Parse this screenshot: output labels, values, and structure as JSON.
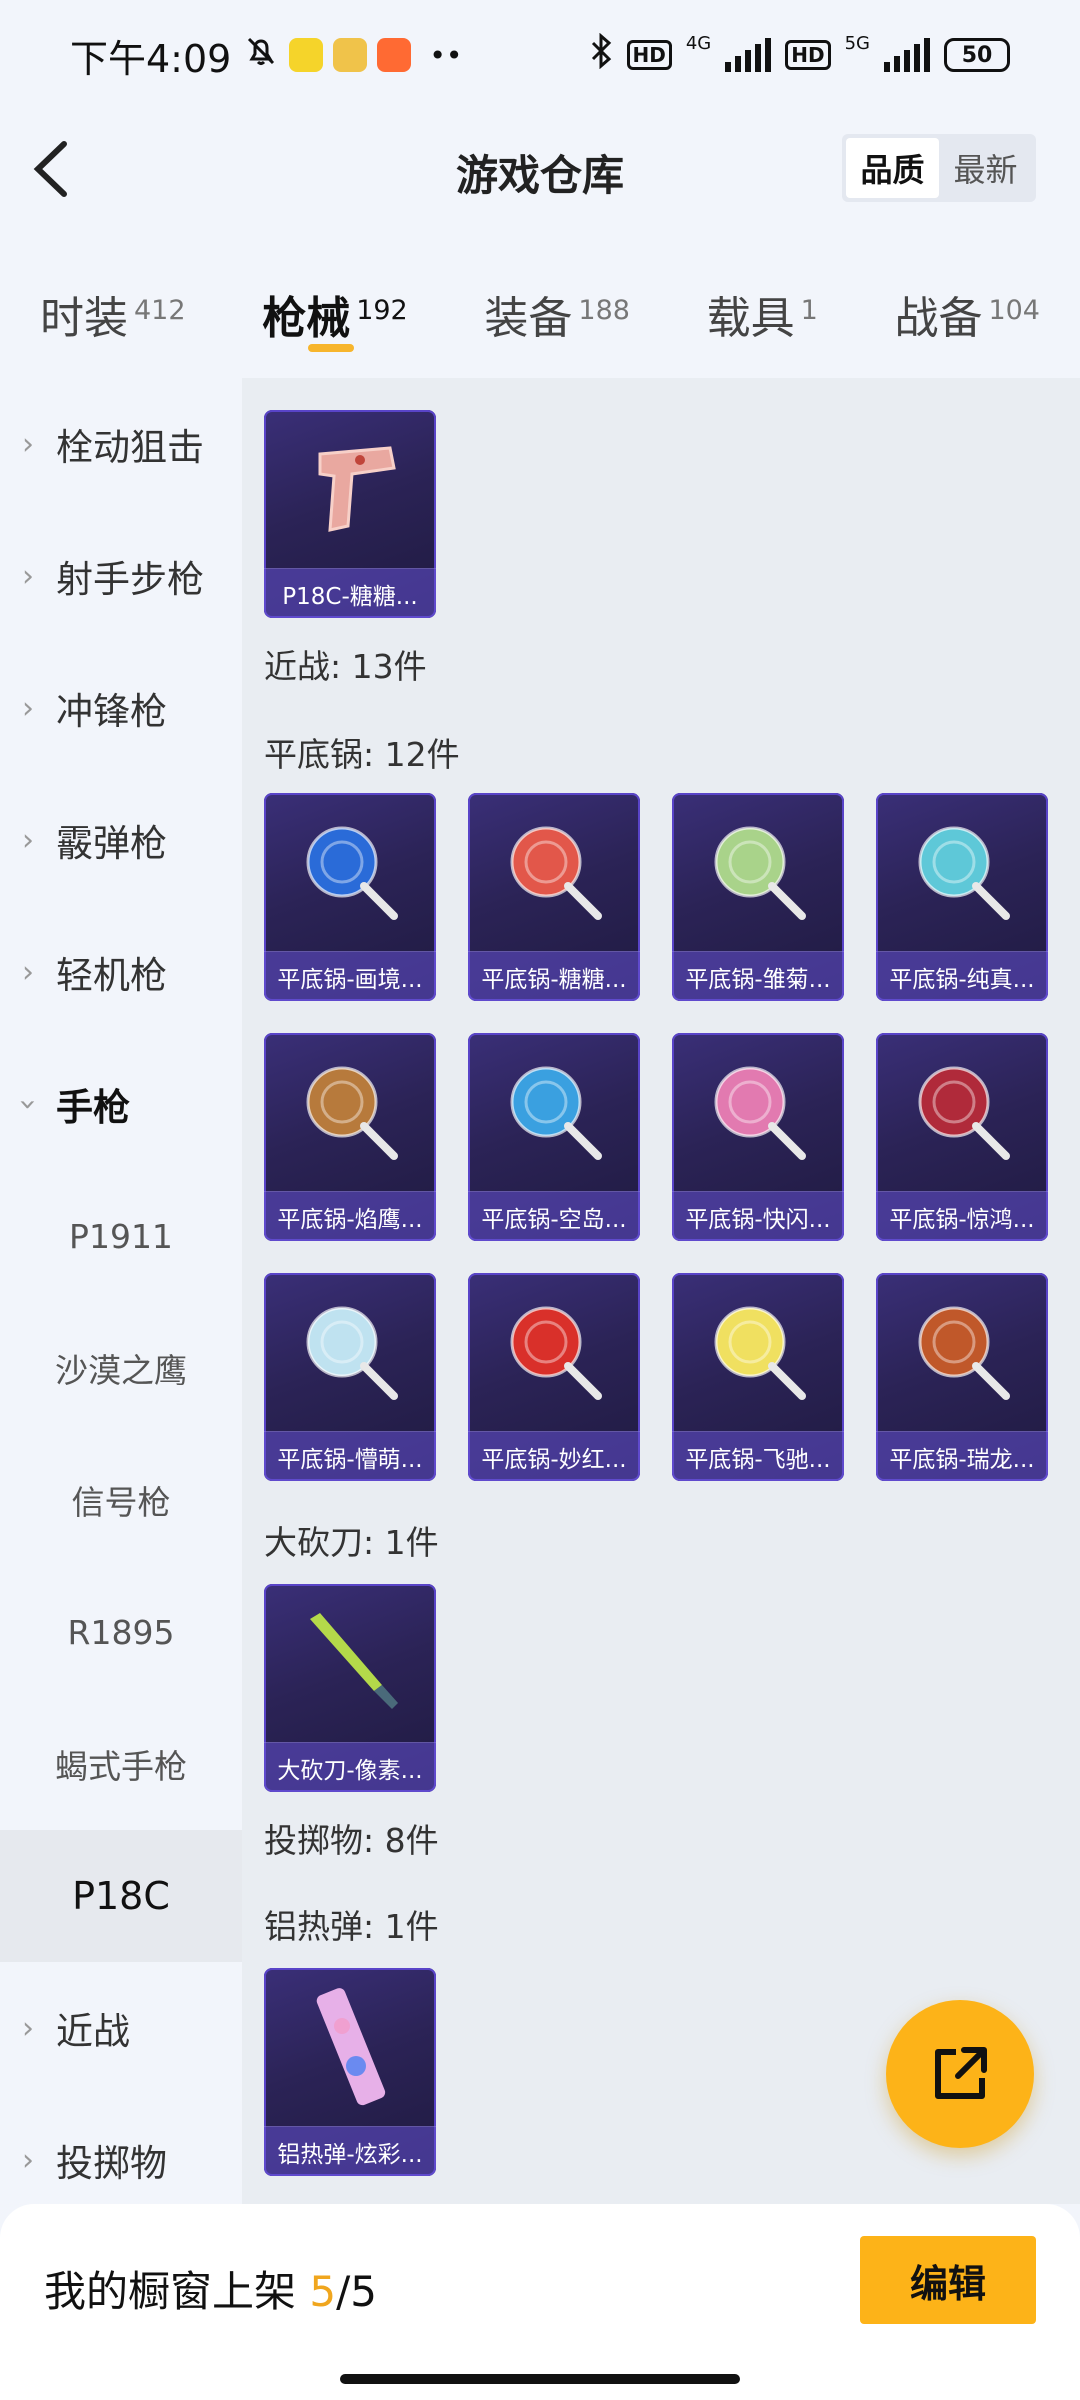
{
  "status_bar": {
    "time": "下午4:09",
    "battery": "50",
    "net1": "4G",
    "net2": "5G",
    "hd": "HD",
    "more": "••"
  },
  "header": {
    "title": "游戏仓库",
    "sort_options": [
      "品质",
      "最新"
    ],
    "active_sort": "品质"
  },
  "tabs": [
    {
      "label": "时装",
      "count": "412"
    },
    {
      "label": "枪械",
      "count": "192"
    },
    {
      "label": "装备",
      "count": "188"
    },
    {
      "label": "载具",
      "count": "1"
    },
    {
      "label": "战备",
      "count": "104"
    }
  ],
  "active_tab": "枪械",
  "sidebar": {
    "items": [
      {
        "label": "栓动狙击"
      },
      {
        "label": "射手步枪"
      },
      {
        "label": "冲锋枪"
      },
      {
        "label": "霰弹枪"
      },
      {
        "label": "轻机枪"
      },
      {
        "label": "手枪"
      },
      {
        "label": "P1911"
      },
      {
        "label": "沙漠之鹰"
      },
      {
        "label": "信号枪"
      },
      {
        "label": "R1895"
      },
      {
        "label": "蝎式手枪"
      },
      {
        "label": "P18C"
      },
      {
        "label": "近战"
      },
      {
        "label": "投掷物"
      }
    ],
    "selected": "P18C"
  },
  "content": {
    "p18c_item": "P18C-糖糖...",
    "melee_header": "近战: 13件",
    "pan_header": "平底锅: 12件",
    "pan_items": [
      "平底锅-画境...",
      "平底锅-糖糖...",
      "平底锅-雏菊...",
      "平底锅-纯真...",
      "平底锅-焰鹰...",
      "平底锅-空岛...",
      "平底锅-快闪...",
      "平底锅-惊鸿...",
      "平底锅-懵萌...",
      "平底锅-妙红...",
      "平底锅-飞驰...",
      "平底锅-瑞龙..."
    ],
    "machete_header": "大砍刀: 1件",
    "machete_item": "大砍刀-像素...",
    "throwable_header": "投掷物: 8件",
    "thermite_header": "铝热弹: 1件",
    "thermite_item": "铝热弹-炫彩..."
  },
  "bottom_bar": {
    "label": "我的橱窗上架 ",
    "current": "5",
    "total": "/5",
    "edit_label": "编辑"
  },
  "colors": {
    "accent": "#fdb318",
    "card_bg": "#2b2356",
    "card_caption": "#6450d2"
  }
}
